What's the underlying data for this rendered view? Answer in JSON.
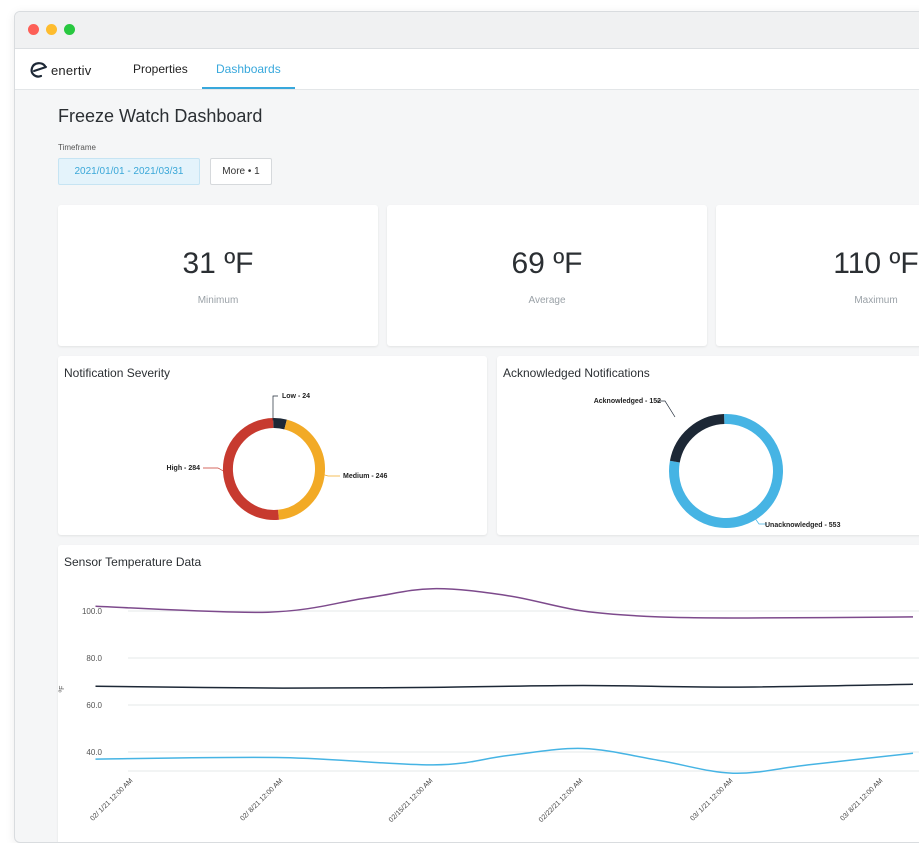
{
  "app": {
    "logo_text": "enertiv",
    "nav": [
      {
        "label": "Properties",
        "active": false
      },
      {
        "label": "Dashboards",
        "active": true
      }
    ]
  },
  "page": {
    "title": "Freeze Watch Dashboard",
    "timeframe_label": "Timeframe",
    "timeframe_value": "2021/01/01 - 2021/03/31",
    "more_button": "More • 1"
  },
  "stats": [
    {
      "value": "31 ºF",
      "label": "Minimum"
    },
    {
      "value": "69 ºF",
      "label": "Average"
    },
    {
      "value": "110 ºF",
      "label": "Maximum"
    }
  ],
  "colors": {
    "accent": "#38a8dc",
    "high": "#c73a2f",
    "medium": "#f2aa26",
    "low": "#1d2836",
    "acknowledged": "#1d2836",
    "unacknowledged": "#46b4e4",
    "series_purple": "#7d4a8c",
    "series_black": "#1d2836",
    "series_blue": "#46b4e4"
  },
  "severity": {
    "title": "Notification Severity",
    "slices": [
      {
        "name": "Low",
        "value": 24,
        "label": "Low - 24"
      },
      {
        "name": "Medium",
        "value": 246,
        "label": "Medium - 246"
      },
      {
        "name": "High",
        "value": 284,
        "label": "High - 284"
      }
    ]
  },
  "acknowledged": {
    "title": "Acknowledged Notifications",
    "slices": [
      {
        "name": "Unacknowledged",
        "value": 553,
        "label": "Unacknowledged - 553"
      },
      {
        "name": "Acknowledged",
        "value": 152,
        "label": "Acknowledged - 152"
      }
    ]
  },
  "sensor": {
    "title": "Sensor Temperature Data",
    "ylabel": "ºF"
  },
  "chart_data": [
    {
      "type": "pie",
      "title": "Notification Severity",
      "categories": [
        "Low",
        "Medium",
        "High"
      ],
      "values": [
        24,
        246,
        284
      ]
    },
    {
      "type": "pie",
      "title": "Acknowledged Notifications",
      "categories": [
        "Unacknowledged",
        "Acknowledged"
      ],
      "values": [
        553,
        152
      ]
    },
    {
      "type": "line",
      "title": "Sensor Temperature Data",
      "ylabel": "ºF",
      "xlabel": "",
      "ylim": [
        30,
        110
      ],
      "yticks": [
        "100.0",
        "80.0",
        "60.0",
        "40.0"
      ],
      "ytick_values": [
        100,
        80,
        60,
        40
      ],
      "x": [
        "02/ 1/21 12:00 AM",
        "02/ 8/21 12:00 AM",
        "02/15/21 12:00 AM",
        "02/22/21 12:00 AM",
        "03/ 1/21 12:00 AM",
        "03/ 8/21 12:00 AM"
      ],
      "x_pos": [
        0,
        1,
        2,
        3,
        4,
        5
      ],
      "grid": true,
      "series": [
        {
          "color": "#7d4a8c",
          "x": [
            -0.25,
            0.9,
            1.55,
            2.0,
            2.5,
            3.0,
            3.5,
            4.1,
            5.2
          ],
          "y": [
            102.0,
            99.5,
            105.5,
            109.5,
            106.5,
            100.0,
            97.5,
            97.0,
            97.5
          ]
        },
        {
          "color": "#1d2836",
          "x": [
            -0.25,
            1.0,
            2.0,
            3.0,
            4.0,
            5.2
          ],
          "y": [
            68.0,
            67.2,
            67.5,
            68.3,
            67.6,
            68.8
          ]
        },
        {
          "color": "#46b4e4",
          "x": [
            -0.25,
            1.0,
            2.0,
            2.5,
            3.0,
            3.5,
            4.0,
            4.5,
            5.2
          ],
          "y": [
            37.0,
            37.6,
            34.5,
            38.5,
            41.5,
            36.5,
            31.0,
            34.5,
            39.5
          ]
        }
      ]
    }
  ]
}
